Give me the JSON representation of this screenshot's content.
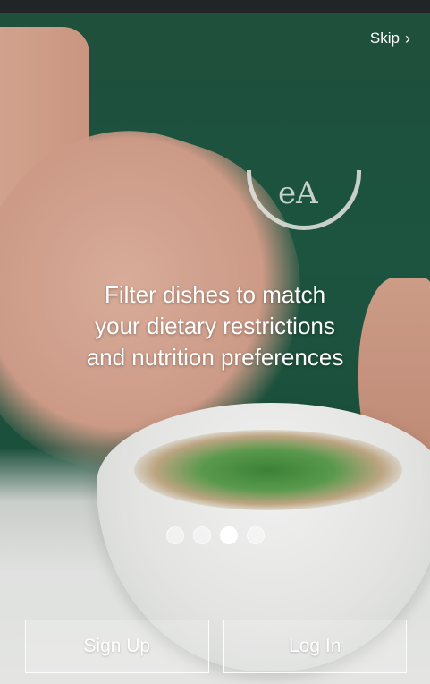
{
  "header": {
    "skip_label": "Skip",
    "skip_icon": "chevron-right-icon"
  },
  "onboarding": {
    "headline_lines": [
      "Filter dishes to match",
      "your dietary restrictions",
      "and nutrition preferences"
    ],
    "page_indicator": {
      "total": 4,
      "active_index": 2
    }
  },
  "actions": {
    "sign_up_label": "Sign Up",
    "log_in_label": "Log In"
  },
  "colors": {
    "text": "#ffffff",
    "apron_green": "#1e5a44"
  }
}
